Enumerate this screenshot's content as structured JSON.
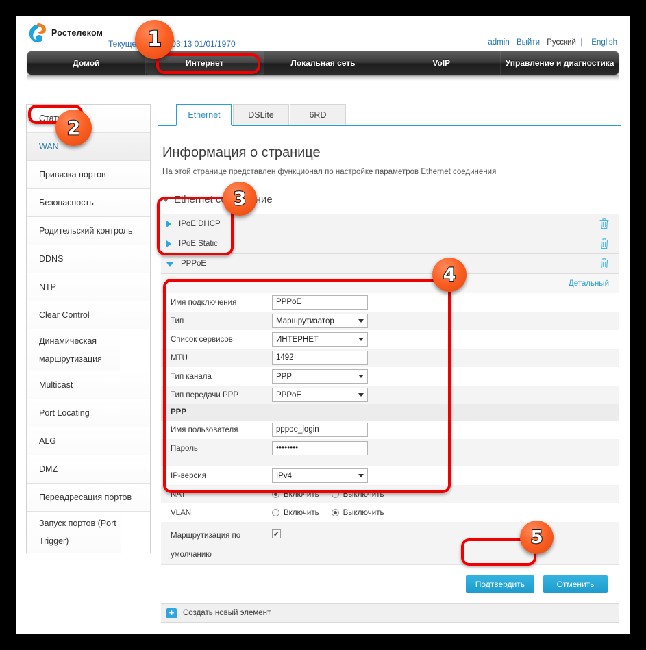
{
  "header": {
    "logo_text": "Ростелеком",
    "current_time_label": "Текущее время: 03:13 01/01/1970",
    "user": "admin",
    "logout": "Выйти",
    "lang_ru": "Русский",
    "lang_sep": "|",
    "lang_en": "English"
  },
  "nav": {
    "items": [
      {
        "label": "Домой",
        "active": false
      },
      {
        "label": "Интернет",
        "active": true
      },
      {
        "label": "Локальная сеть",
        "active": false
      },
      {
        "label": "VoIP",
        "active": false
      },
      {
        "label": "Управление и диагностика",
        "active": false
      }
    ]
  },
  "sidebar": {
    "items": [
      {
        "label": "Статус",
        "selected": false
      },
      {
        "label": "WAN",
        "selected": true
      },
      {
        "label": "Привязка портов",
        "selected": false
      },
      {
        "label": "Безопасность",
        "selected": false
      },
      {
        "label": "Родительский контроль",
        "selected": false
      },
      {
        "label": "DDNS",
        "selected": false
      },
      {
        "label": "NTP",
        "selected": false
      },
      {
        "label": "Clear Control",
        "selected": false
      },
      {
        "label": "Динамическая маршрутизация",
        "selected": false
      },
      {
        "label": "Multicast",
        "selected": false
      },
      {
        "label": "Port Locating",
        "selected": false
      },
      {
        "label": "ALG",
        "selected": false
      },
      {
        "label": "DMZ",
        "selected": false
      },
      {
        "label": "Переадресация портов",
        "selected": false
      },
      {
        "label": "Запуск портов (Port Trigger)",
        "selected": false
      }
    ]
  },
  "tabs": [
    {
      "label": "Ethernet",
      "active": true
    },
    {
      "label": "DSLite",
      "active": false
    },
    {
      "label": "6RD",
      "active": false
    }
  ],
  "page": {
    "title": "Информация о странице",
    "description": "На этой странице представлен функционал по настройке параметров Ethernet соединения",
    "section_title": "Ethernet соединение"
  },
  "connections": [
    {
      "label": "IPoE DHCP",
      "expanded": false
    },
    {
      "label": "IPoE Static",
      "expanded": false
    },
    {
      "label": "PPPoE",
      "expanded": true
    }
  ],
  "detail_link": "Детальный",
  "form": {
    "connection_name": {
      "label": "Имя подключения",
      "value": "PPPoE"
    },
    "type": {
      "label": "Тип",
      "value": "Маршрутизатор"
    },
    "service_list": {
      "label": "Список сервисов",
      "value": "ИНТЕРНЕТ"
    },
    "mtu": {
      "label": "MTU",
      "value": "1492"
    },
    "channel_type": {
      "label": "Тип канала",
      "value": "PPP"
    },
    "ppp_transfer_type": {
      "label": "Тип передачи PPP",
      "value": "PPPoE"
    },
    "ppp_group": "PPP",
    "username": {
      "label": "Имя пользователя",
      "value": "pppoe_login"
    },
    "password": {
      "label": "Пароль",
      "value": "••••••••"
    },
    "ip_version": {
      "label": "IP-версия",
      "value": "IPv4"
    },
    "nat": {
      "label": "NAT",
      "on": "Включить",
      "off": "Выключить",
      "selected": "on"
    },
    "vlan": {
      "label": "VLAN",
      "on": "Включить",
      "off": "Выключить",
      "selected": "off"
    },
    "default_route": {
      "label": "Маршрутизация по умолчанию",
      "checked": true,
      "check_glyph": "✔"
    }
  },
  "buttons": {
    "confirm": "Подтвердить",
    "cancel": "Отменить"
  },
  "create_row": {
    "icon": "+",
    "label": "Создать новый элемент"
  },
  "markers": [
    {
      "number": "1"
    },
    {
      "number": "2"
    },
    {
      "number": "3"
    },
    {
      "number": "4"
    },
    {
      "number": "5"
    }
  ],
  "colors": {
    "accent_blue": "#2b9fd4",
    "marker_orange": "#fb5f22",
    "annotation_red": "#f00000"
  }
}
